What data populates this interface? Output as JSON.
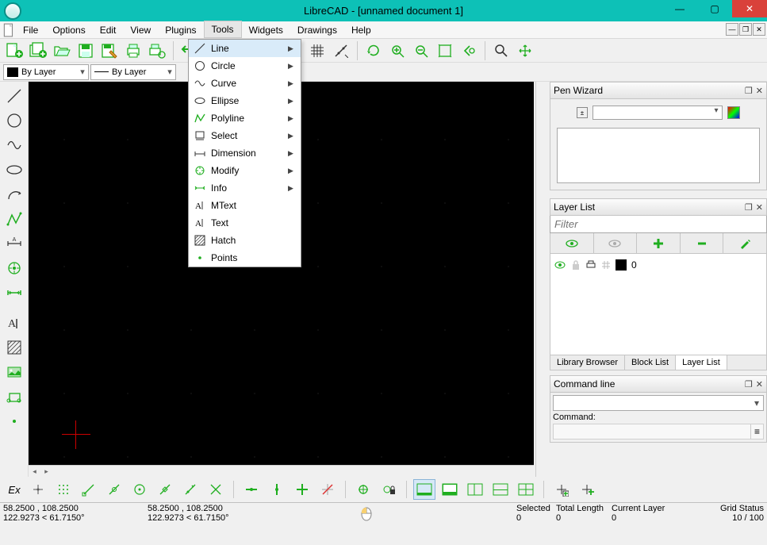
{
  "title": "LibreCAD - [unnamed document 1]",
  "menubar": [
    "File",
    "Options",
    "Edit",
    "View",
    "Plugins",
    "Tools",
    "Widgets",
    "Drawings",
    "Help"
  ],
  "menubar_open_index": 5,
  "tools_menu": [
    {
      "label": "Line",
      "sub": true,
      "hi": true,
      "icon": "line"
    },
    {
      "label": "Circle",
      "sub": true,
      "icon": "circle"
    },
    {
      "label": "Curve",
      "sub": true,
      "icon": "curve"
    },
    {
      "label": "Ellipse",
      "sub": true,
      "icon": "ellipse"
    },
    {
      "label": "Polyline",
      "sub": true,
      "icon": "polyline"
    },
    {
      "label": "Select",
      "sub": true,
      "icon": "select"
    },
    {
      "label": "Dimension",
      "sub": true,
      "icon": "dim"
    },
    {
      "label": "Modify",
      "sub": true,
      "icon": "modify"
    },
    {
      "label": "Info",
      "sub": true,
      "icon": "info"
    },
    {
      "label": "MText",
      "sub": false,
      "icon": "mtext"
    },
    {
      "label": "Text",
      "sub": false,
      "icon": "text"
    },
    {
      "label": "Hatch",
      "sub": false,
      "icon": "hatch"
    },
    {
      "label": "Points",
      "sub": false,
      "icon": "points"
    }
  ],
  "layer_combo": "By Layer",
  "linetype_combo": "By Layer",
  "penwizard": {
    "title": "Pen Wizard"
  },
  "layerlist": {
    "title": "Layer List",
    "filter_placeholder": "Filter",
    "layers": [
      {
        "name": "0"
      }
    ],
    "tabs": [
      "Library Browser",
      "Block List",
      "Layer List"
    ],
    "active_tab": 2
  },
  "cmdline": {
    "title": "Command line",
    "label": "Command:"
  },
  "status": {
    "abs": "58.2500 , 108.2500",
    "polar": "122.9273 < 61.7150°",
    "abs2": "58.2500 , 108.2500",
    "polar2": "122.9273 < 61.7150°",
    "sel_lbl": "Selected",
    "sel_val": "0",
    "len_lbl": "Total Length",
    "len_val": "0",
    "layer_lbl": "Current Layer",
    "layer_val": "0",
    "grid_lbl": "Grid Status",
    "grid_val": "10 / 100"
  },
  "ex_label": "Ex"
}
